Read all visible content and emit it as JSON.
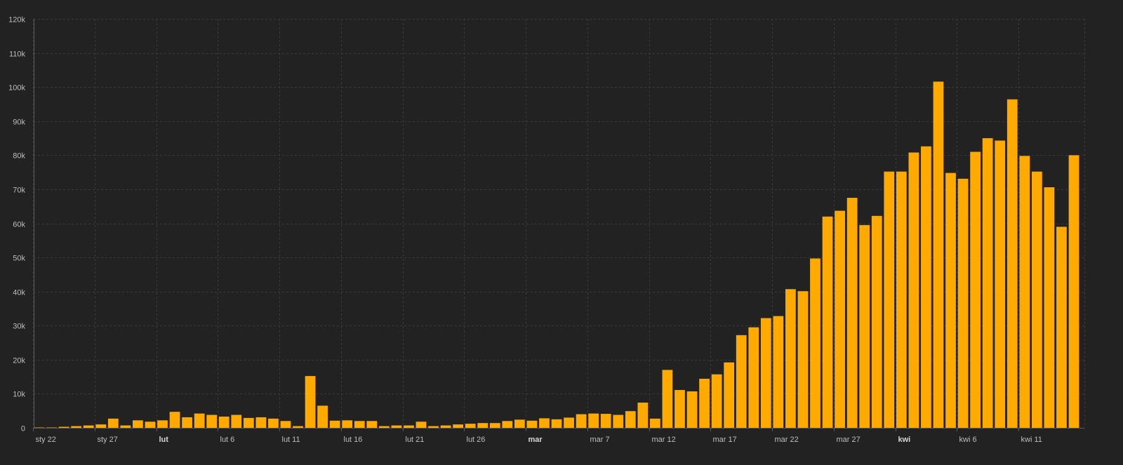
{
  "colors": {
    "background": "#222222",
    "bar": "#FFAA00",
    "grid": "#3a3a3a",
    "text": "#bdbdbd"
  },
  "chart_data": {
    "type": "bar",
    "title": "",
    "xlabel": "",
    "ylabel": "",
    "ylim": [
      0,
      120000
    ],
    "grid": true,
    "y_ticks": [
      {
        "value": 0,
        "label": "0"
      },
      {
        "value": 10000,
        "label": "10k"
      },
      {
        "value": 20000,
        "label": "20k"
      },
      {
        "value": 30000,
        "label": "30k"
      },
      {
        "value": 40000,
        "label": "40k"
      },
      {
        "value": 50000,
        "label": "50k"
      },
      {
        "value": 60000,
        "label": "60k"
      },
      {
        "value": 70000,
        "label": "70k"
      },
      {
        "value": 80000,
        "label": "80k"
      },
      {
        "value": 90000,
        "label": "90k"
      },
      {
        "value": 100000,
        "label": "100k"
      },
      {
        "value": 110000,
        "label": "110k"
      },
      {
        "value": 120000,
        "label": "120k"
      }
    ],
    "x_ticks": [
      {
        "index": 0,
        "label": "sty 22",
        "bold": false
      },
      {
        "index": 5,
        "label": "sty 27",
        "bold": false
      },
      {
        "index": 10,
        "label": "lut",
        "bold": true
      },
      {
        "index": 15,
        "label": "lut 6",
        "bold": false
      },
      {
        "index": 20,
        "label": "lut 11",
        "bold": false
      },
      {
        "index": 25,
        "label": "lut 16",
        "bold": false
      },
      {
        "index": 30,
        "label": "lut 21",
        "bold": false
      },
      {
        "index": 35,
        "label": "lut 26",
        "bold": false
      },
      {
        "index": 40,
        "label": "mar",
        "bold": true
      },
      {
        "index": 45,
        "label": "mar 7",
        "bold": false
      },
      {
        "index": 50,
        "label": "mar 12",
        "bold": false
      },
      {
        "index": 55,
        "label": "mar 17",
        "bold": false
      },
      {
        "index": 60,
        "label": "mar 22",
        "bold": false
      },
      {
        "index": 65,
        "label": "mar 27",
        "bold": false
      },
      {
        "index": 70,
        "label": "kwi",
        "bold": true
      },
      {
        "index": 75,
        "label": "kwi 6",
        "bold": false
      },
      {
        "index": 80,
        "label": "kwi 11",
        "bold": false
      }
    ],
    "categories": [
      "sty 22",
      "sty 23",
      "sty 24",
      "sty 25",
      "sty 26",
      "sty 27",
      "sty 28",
      "sty 29",
      "sty 30",
      "sty 31",
      "lut 1",
      "lut 2",
      "lut 3",
      "lut 4",
      "lut 5",
      "lut 6",
      "lut 7",
      "lut 8",
      "lut 9",
      "lut 10",
      "lut 11",
      "lut 12",
      "lut 13",
      "lut 14",
      "lut 15",
      "lut 16",
      "lut 17",
      "lut 18",
      "lut 19",
      "lut 20",
      "lut 21",
      "lut 22",
      "lut 23",
      "lut 24",
      "lut 25",
      "lut 26",
      "lut 27",
      "lut 28",
      "lut 29",
      "mar 1",
      "mar 2",
      "mar 3",
      "mar 4",
      "mar 5",
      "mar 6",
      "mar 7",
      "mar 8",
      "mar 9",
      "mar 10",
      "mar 11",
      "mar 12",
      "mar 13",
      "mar 14",
      "mar 15",
      "mar 16",
      "mar 17",
      "mar 18",
      "mar 19",
      "mar 20",
      "mar 21",
      "mar 22",
      "mar 23",
      "mar 24",
      "mar 25",
      "mar 26",
      "mar 27",
      "mar 28",
      "mar 29",
      "mar 30",
      "mar 31",
      "kwi 1",
      "kwi 2",
      "kwi 3",
      "kwi 4",
      "kwi 5",
      "kwi 6",
      "kwi 7",
      "kwi 8",
      "kwi 9",
      "kwi 10",
      "kwi 11",
      "kwi 12",
      "kwi 13",
      "kwi 14"
    ],
    "values": [
      100,
      100,
      300,
      500,
      700,
      1000,
      2700,
      700,
      2200,
      1800,
      2200,
      4700,
      3100,
      4200,
      3800,
      3300,
      3800,
      2900,
      3100,
      2700,
      2000,
      500,
      15200,
      6500,
      2100,
      2200,
      2000,
      2000,
      500,
      700,
      700,
      1800,
      500,
      700,
      1000,
      1200,
      1400,
      1400,
      2000,
      2400,
      2100,
      2800,
      2500,
      3000,
      4000,
      4200,
      4100,
      3800,
      4900,
      7400,
      2700,
      17000,
      11100,
      10700,
      14400,
      15700,
      19200,
      27200,
      29500,
      32200,
      32800,
      40700,
      40100,
      49700,
      62000,
      63700,
      67500,
      59500,
      62200,
      75200,
      75200,
      80800,
      82600,
      101600,
      74800,
      73100,
      81000,
      85000,
      84300,
      96400,
      79800,
      75200,
      70600,
      59000,
      80000
    ]
  }
}
